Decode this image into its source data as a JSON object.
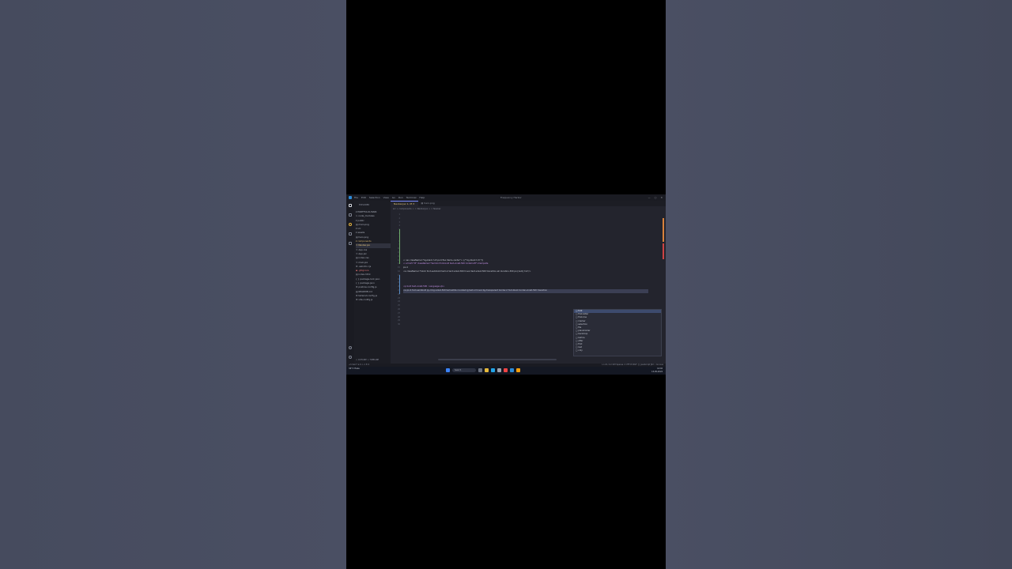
{
  "window": {
    "title": "Frequency Harbor",
    "menu": [
      "File",
      "Edit",
      "Selection",
      "View",
      "Go",
      "Run",
      "Terminal",
      "Help"
    ],
    "controls": [
      "—",
      "▢",
      "✕"
    ]
  },
  "sidebar": {
    "title": "EXPLORER",
    "items": [
      {
        "label": "▾ PORTFOLIO-MAIN",
        "style": ""
      },
      {
        "label": "  > node_modules",
        "style": ""
      },
      {
        "label": "  ▾ public",
        "style": ""
      },
      {
        "label": "    ▤ main.png",
        "style": ""
      },
      {
        "label": "  ▾ src",
        "style": ""
      },
      {
        "label": "    ▾ assets",
        "style": ""
      },
      {
        "label": "      ▤ hero.png",
        "style": ""
      },
      {
        "label": "    ▾ components",
        "style": "mod"
      },
      {
        "label": "      ⚛ Navbar.jsx",
        "style": "sel"
      },
      {
        "label": "    ⚛ App.css",
        "style": ""
      },
      {
        "label": "    ⚛ App.jsx",
        "style": ""
      },
      {
        "label": "    ▤ index.css",
        "style": ""
      },
      {
        "label": "    ⚛ main.jsx",
        "style": ""
      },
      {
        "label": "  ⚙ .eslintrc.cjs",
        "style": ""
      },
      {
        "label": "  ◆ .gitignore",
        "style": "red"
      },
      {
        "label": "  ▤ index.html",
        "style": ""
      },
      {
        "label": "  { } package-lock.json",
        "style": ""
      },
      {
        "label": "  { } package.json",
        "style": ""
      },
      {
        "label": "  ⚙ postcss.config.js",
        "style": ""
      },
      {
        "label": "  ▤ README.md",
        "style": ""
      },
      {
        "label": "  ⚙ tailwind.config.js",
        "style": ""
      },
      {
        "label": "  ⚙ vite.config.js",
        "style": ""
      }
    ],
    "outline": "> OUTLINE    > TIMELINE"
  },
  "editor": {
    "tabs": [
      {
        "label": "Navbar.jsx 1, M  ✕",
        "active": true
      },
      {
        "label": "▤ hero.png",
        "active": false
      }
    ],
    "breadcrumb": "src > components > ⚛ Navbar.jsx > ⚛ Navbar",
    "line_numbers": [
      "1",
      "2",
      "3",
      "4",
      "5",
      "6",
      "7",
      "8",
      "9",
      "10",
      "11",
      "12",
      "13",
      "14",
      "15",
      "16",
      "17",
      "18",
      "19",
      "20",
      "21",
      "22",
      "23",
      "24",
      "25",
      "26",
      "27",
      "28",
      "29",
      "30"
    ],
    "code_lines": [
      {
        "text": "",
        "cls": ""
      },
      {
        "text": "",
        "cls": ""
      },
      {
        "text": "",
        "cls": ""
      },
      {
        "text": "",
        "cls": ""
      },
      {
        "text": "",
        "cls": ""
      },
      {
        "text": "",
        "cls": ""
      },
      {
        "text": "",
        "cls": ""
      },
      {
        "text": "",
        "cls": ""
      },
      {
        "text": "",
        "cls": ""
      },
      {
        "text": "",
        "cls": ""
      },
      {
        "text": "",
        "cls": ""
      },
      {
        "text": "",
        "cls": ""
      },
      {
        "text": "< nav className=\"bg-black h-8 px-6 flex items-center\"> {/* bg-black h-8 */}",
        "cls": ""
      },
      {
        "text": "< a href=\"#\" className=\"text-2xl font-bold text-violet-500 CodeCraft\">Campsite",
        "cls": "kw"
      },
      {
        "text": "  px-4 ",
        "cls": ""
      },
      {
        "text": "  <a className=\"block font-semibold text-xl text-violet-300 hover:text-violet-500 transition-all duration-300 px-[1em] hrs\"/>",
        "cls": ""
      },
      {
        "text": "",
        "cls": ""
      },
      {
        "text": "",
        "cls": ""
      },
      {
        "text": "",
        "cls": ""
      },
      {
        "text": "<p bold text-violet-500 : Language</p>",
        "cls": "kw"
      },
      {
        "text": "<a px-4 font-semibold py-4 bg-violet-500 text-white rounded-lg text-xl hover:bg-transparent border-2 font-black border-violet-500 transition",
        "cls": "hl"
      },
      {
        "text": "",
        "cls": ""
      },
      {
        "text": "",
        "cls": ""
      },
      {
        "text": "",
        "cls": ""
      },
      {
        "text": "",
        "cls": ""
      },
      {
        "text": "",
        "cls": ""
      },
      {
        "text": "",
        "cls": ""
      },
      {
        "text": "",
        "cls": ""
      },
      {
        "text": "",
        "cls": ""
      },
      {
        "text": "",
        "cls": ""
      }
    ],
    "suggestions": [
      {
        "label": "▢ font",
        "on": true
      },
      {
        "label": "▢ first-letter",
        "on": false
      },
      {
        "label": "▢ first-line",
        "on": false
      },
      {
        "label": "▢ marker",
        "on": false
      },
      {
        "label": "▢ selection",
        "on": false
      },
      {
        "label": "▢ file",
        "on": false
      },
      {
        "label": "▢ placeholder",
        "on": false
      },
      {
        "label": "▢ backdrop",
        "on": false
      },
      {
        "label": "▢ before",
        "on": false
      },
      {
        "label": "▢ after",
        "on": false
      },
      {
        "label": "▢ first",
        "on": false
      },
      {
        "label": "▢ last",
        "on": false
      },
      {
        "label": "▢ only",
        "on": false
      }
    ]
  },
  "statusbar": {
    "left": "⎇ main*  ⊗ 0 ⚠ 1  ⚑ 0",
    "right": "Ln 21, Col 103  Spaces: 2  UTF-8  CRLF  {} JavaScript JSX  ⚡ Go Live"
  },
  "taskbar": {
    "weather": "34°C  Haze",
    "search_label": "Search",
    "clock_time": "14:02",
    "clock_date": "13-05-2024"
  },
  "colors": {
    "accent_blue": "#2c8bd8",
    "git_added": "#6fae6b",
    "modified": "#d9b66b"
  }
}
